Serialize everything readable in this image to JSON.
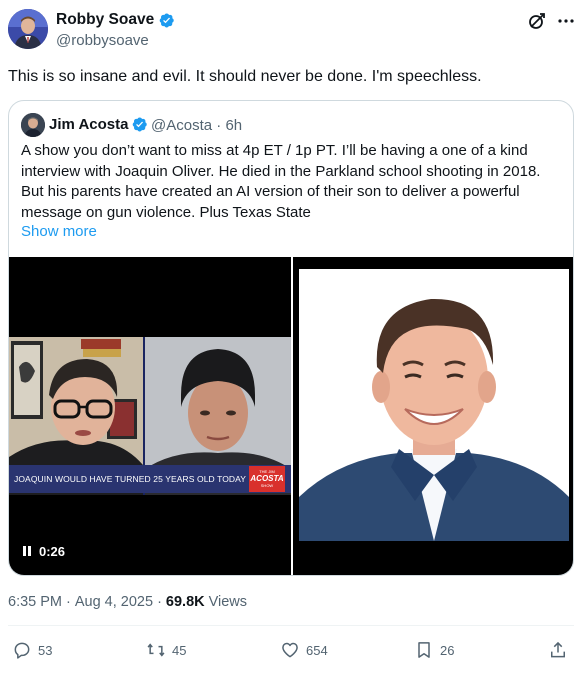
{
  "author": {
    "name": "Robby Soave",
    "handle": "@robbysoave"
  },
  "tweet": {
    "text": "This is so insane and evil. It should never be done. I'm speechless."
  },
  "quoted": {
    "name": "Jim Acosta",
    "handle": "@Acosta",
    "separator": "·",
    "age": "6h",
    "text": "A show you don’t want to miss at 4p ET / 1p PT. I’ll be having a one of a kind interview with Joaquin Oliver. He died in the Parkland school shooting in 2018. But his parents have created an AI version of their son to deliver a powerful message on gun violence. Plus Texas State",
    "show_more": "Show more",
    "video": {
      "chyron": "JOAQUIN WOULD HAVE TURNED 25 YEARS OLD TODAY",
      "logo_top": "THE JIM",
      "logo_mid": "ACOSTA",
      "logo_bot": "SHOW",
      "time": "0:26"
    }
  },
  "meta": {
    "time": "6:35 PM",
    "dot1": "·",
    "date": "Aug 4, 2025",
    "dot2": "·",
    "views_count": "69.8K",
    "views_label": "Views"
  },
  "actions": {
    "replies": "53",
    "reposts": "45",
    "likes": "654",
    "bookmarks": "26"
  },
  "colors": {
    "accent": "#1d9bf0",
    "secondary_text": "#536471",
    "border": "#cfd9de"
  }
}
